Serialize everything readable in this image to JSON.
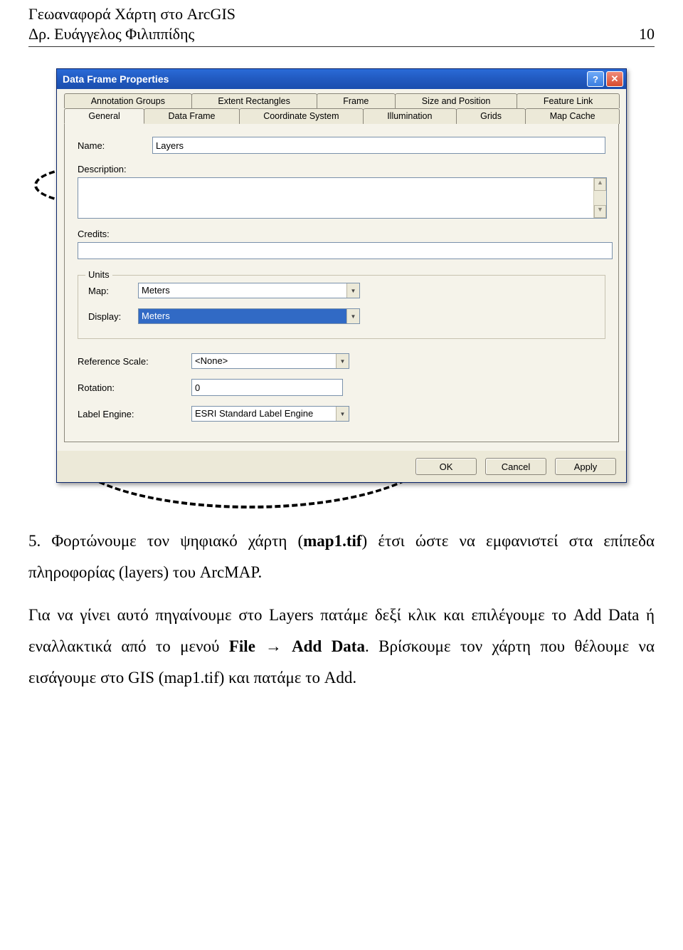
{
  "page_header": {
    "title1": "Γεωαναφορά Χάρτη στο ArcGIS",
    "title2": "Δρ. Ευάγγελος Φιλιππίδης",
    "page_number": "10"
  },
  "dialog": {
    "title": "Data Frame Properties",
    "help_btn": "?",
    "close_btn": "✕",
    "tabs_top": [
      "Annotation Groups",
      "Extent Rectangles",
      "Frame",
      "Size and Position",
      "Feature Link"
    ],
    "tabs_bottom": [
      "General",
      "Data Frame",
      "Coordinate System",
      "Illumination",
      "Grids",
      "Map Cache"
    ],
    "active_tab": "General",
    "fields": {
      "name_label": "Name:",
      "name_value": "Layers",
      "description_label": "Description:",
      "credits_label": "Credits:",
      "units_legend": "Units",
      "map_label": "Map:",
      "map_value": "Meters",
      "display_label": "Display:",
      "display_value": "Meters",
      "refscale_label": "Reference Scale:",
      "refscale_value": "<None>",
      "rotation_label": "Rotation:",
      "rotation_value": "0",
      "labelengine_label": "Label Engine:",
      "labelengine_value": "ESRI Standard Label Engine"
    },
    "buttons": {
      "ok": "OK",
      "cancel": "Cancel",
      "apply": "Apply"
    }
  },
  "paragraph": {
    "lead_number": "5.",
    "part1": " Φορτώνουμε τον ψηφιακό χάρτη (",
    "bold1": "map1.tif",
    "part2": ") έτσι ώστε να εμφανιστεί στα επίπεδα πληροφορίας (layers) του ArcMAP.",
    "part3": "Για να γίνει αυτό πηγαίνουμε στο Layers πατάμε δεξί κλικ και επιλέγουμε το Add Data ή εναλλακτικά από το μενού ",
    "bold2": "File",
    "arrow": " → ",
    "bold3": "Add Data",
    "part4": ". Βρίσκουμε τον χάρτη που θέλουμε να εισάγουμε στο GIS (map1.tif) και πατάμε το Add."
  }
}
